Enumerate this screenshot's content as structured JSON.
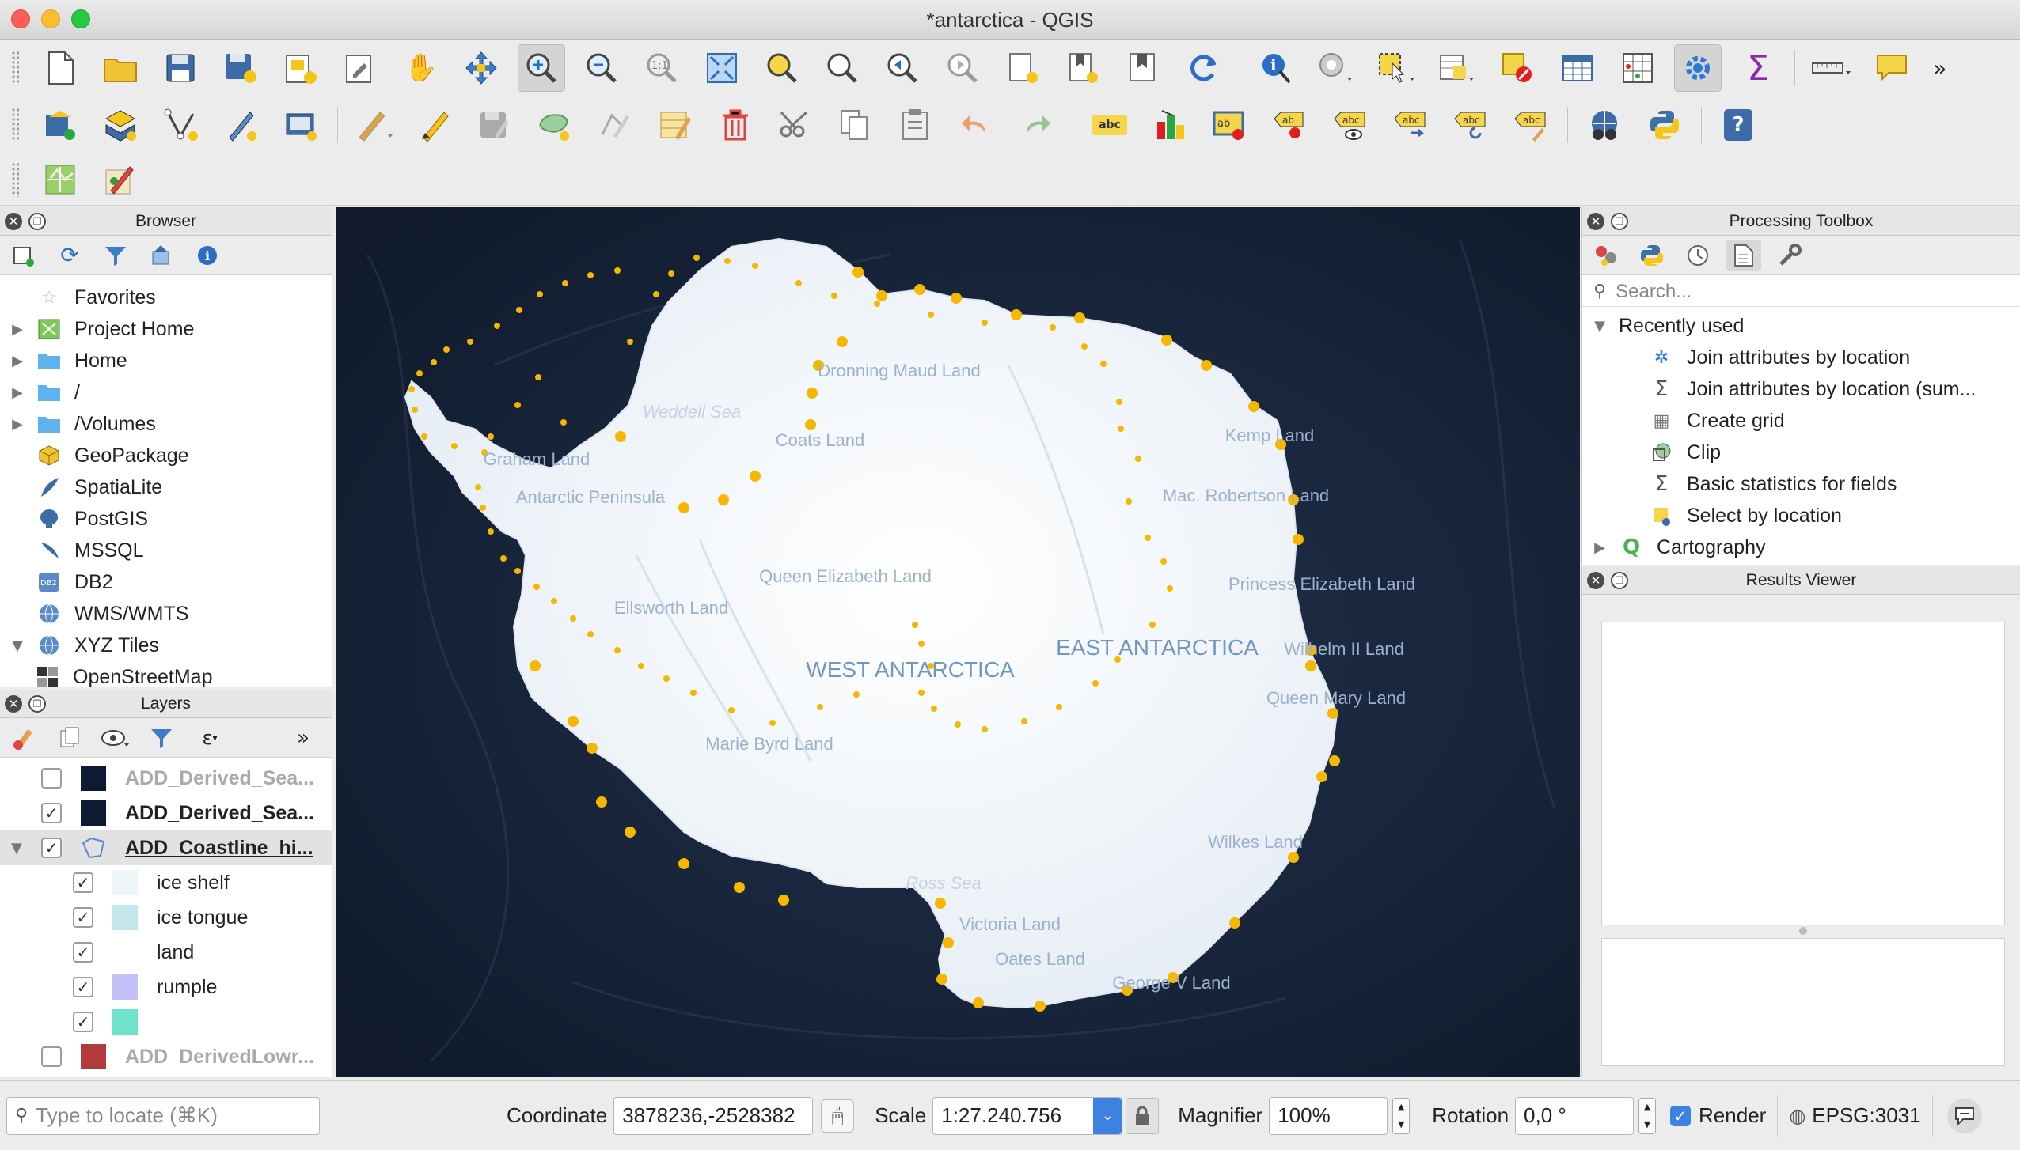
{
  "window": {
    "title": "*antarctica - QGIS"
  },
  "colors": {
    "ocean": "#172338",
    "ice": "#f3f6fa",
    "coast_point": "#f5b700",
    "map_label": "#9ab2cc",
    "region_label": "#6f97c4"
  },
  "toolbar": {
    "row1_icons": [
      "new-project-icon",
      "open-project-icon",
      "save-project-icon",
      "save-as-icon",
      "new-print-layout-icon",
      "layout-manager-icon",
      "pan-icon",
      "pan-to-selection-icon",
      "zoom-in-icon",
      "zoom-out-icon",
      "zoom-native-icon",
      "zoom-full-icon",
      "zoom-to-selection-icon",
      "zoom-to-layer-icon",
      "zoom-last-icon",
      "zoom-next-icon",
      "new-map-view-icon",
      "new-bookmark-icon",
      "show-bookmarks-icon",
      "refresh-icon",
      "identify-icon",
      "action-icon",
      "select-features-icon",
      "open-attribute-table-icon",
      "deselect-icon",
      "attribute-table-icon",
      "field-calculator-icon",
      "processing-toolbox-icon",
      "statistics-icon",
      "measure-icon",
      "map-tips-icon"
    ],
    "row2_icons": [
      "digitize-icon",
      "layer-add-icon",
      "vertex-tool-icon",
      "digitize-pen-icon",
      "layer-save-icon",
      "edit-pencil-icon",
      "toggle-editing-icon",
      "save-edits-icon",
      "add-feature-icon",
      "vertex-editor-icon",
      "modify-attributes-icon",
      "delete-selected-icon",
      "cut-features-icon",
      "copy-features-icon",
      "paste-features-icon",
      "undo-icon",
      "redo-icon",
      "label-toolbar-icon",
      "diagram-icon",
      "highlight-label-icon",
      "pin-label-icon",
      "show-hide-labels-icon",
      "move-label-icon",
      "rotate-label-icon",
      "change-label-icon",
      "metasearch-icon",
      "python-console-icon",
      "help-icon"
    ],
    "row3_icons": [
      "georeferencer-icon",
      "style-editor-icon"
    ]
  },
  "browser": {
    "title": "Browser",
    "items": [
      {
        "label": "Favorites",
        "icon": "star-icon",
        "expand": ""
      },
      {
        "label": "Project Home",
        "icon": "project-home-icon",
        "expand": "▶"
      },
      {
        "label": "Home",
        "icon": "folder-icon",
        "expand": "▶"
      },
      {
        "label": "/",
        "icon": "folder-icon",
        "expand": "▶"
      },
      {
        "label": "/Volumes",
        "icon": "folder-icon",
        "expand": "▶"
      },
      {
        "label": "GeoPackage",
        "icon": "geopackage-icon",
        "expand": ""
      },
      {
        "label": "SpatiaLite",
        "icon": "spatialite-icon",
        "expand": ""
      },
      {
        "label": "PostGIS",
        "icon": "postgis-icon",
        "expand": ""
      },
      {
        "label": "MSSQL",
        "icon": "mssql-icon",
        "expand": ""
      },
      {
        "label": "DB2",
        "icon": "db2-icon",
        "expand": ""
      },
      {
        "label": "WMS/WMTS",
        "icon": "globe-icon",
        "expand": ""
      },
      {
        "label": "XYZ Tiles",
        "icon": "globe-icon",
        "expand": "▼"
      },
      {
        "label": "OpenStreetMap",
        "icon": "grid-icon",
        "expand": ""
      }
    ]
  },
  "layers": {
    "title": "Layers",
    "items": [
      {
        "label": "ADD_Derived_Sea...",
        "checked": false,
        "color": "#0e1a33",
        "bold": false,
        "dim": true
      },
      {
        "label": "ADD_Derived_Sea...",
        "checked": true,
        "color": "#0e1a33",
        "bold": true,
        "dim": false
      },
      {
        "label": "ADD_Coastline_hi...",
        "checked": true,
        "color": "",
        "bold": true,
        "dim": false
      },
      {
        "label": "ice shelf",
        "checked": true,
        "color": "#eef6fa",
        "bold": false,
        "dim": false
      },
      {
        "label": "ice tongue",
        "checked": true,
        "color": "#c2e6ec",
        "bold": false,
        "dim": false
      },
      {
        "label": "land",
        "checked": true,
        "color": "#ffffff",
        "bold": false,
        "dim": false
      },
      {
        "label": "rumple",
        "checked": true,
        "color": "#c4c0fa",
        "bold": false,
        "dim": false
      },
      {
        "label": "",
        "checked": true,
        "color": "#6ee2ca",
        "bold": false,
        "dim": false
      },
      {
        "label": "ADD_DerivedLowr...",
        "checked": false,
        "color": "#b33a3a",
        "bold": false,
        "dim": true
      }
    ]
  },
  "processing": {
    "title": "Processing Toolbox",
    "search_placeholder": "Search...",
    "group": "Recently used",
    "items": [
      {
        "label": "Join attributes by location",
        "icon": "gear-icon"
      },
      {
        "label": "Join attributes by location (sum...",
        "icon": "sigma-icon"
      },
      {
        "label": "Create grid",
        "icon": "grid-icon"
      },
      {
        "label": "Clip",
        "icon": "clip-icon"
      },
      {
        "label": "Basic statistics for fields",
        "icon": "sigma-icon"
      },
      {
        "label": "Select by location",
        "icon": "select-location-icon"
      }
    ],
    "group2": "Cartography"
  },
  "results": {
    "title": "Results Viewer"
  },
  "map": {
    "labels": [
      {
        "text": "Dronning Maud Land"
      },
      {
        "text": "Weddell Sea"
      },
      {
        "text": "Coats Land"
      },
      {
        "text": "Kemp Land"
      },
      {
        "text": "Graham Land"
      },
      {
        "text": "Antarctic Peninsula"
      },
      {
        "text": "Mac. Robertson Land"
      },
      {
        "text": "Queen Elizabeth Land"
      },
      {
        "text": "Princess Elizabeth Land"
      },
      {
        "text": "Ellsworth Land"
      },
      {
        "text": "WEST ANTARCTICA"
      },
      {
        "text": "EAST ANTARCTICA"
      },
      {
        "text": "Wilhelm II Land"
      },
      {
        "text": "Queen Mary Land"
      },
      {
        "text": "Marie Byrd Land"
      },
      {
        "text": "Wilkes Land"
      },
      {
        "text": "Ross Sea"
      },
      {
        "text": "Victoria Land"
      },
      {
        "text": "Oates Land"
      },
      {
        "text": "George V Land"
      }
    ]
  },
  "status": {
    "locate_placeholder": "Type to locate (⌘K)",
    "coordinate_label": "Coordinate",
    "coordinate": "3878236,-2528382",
    "scale_label": "Scale",
    "scale": "1:27.240.756",
    "magnifier_label": "Magnifier",
    "magnifier": "100%",
    "rotation_label": "Rotation",
    "rotation": "0,0 °",
    "render_label": "Render",
    "crs": "EPSG:3031"
  }
}
